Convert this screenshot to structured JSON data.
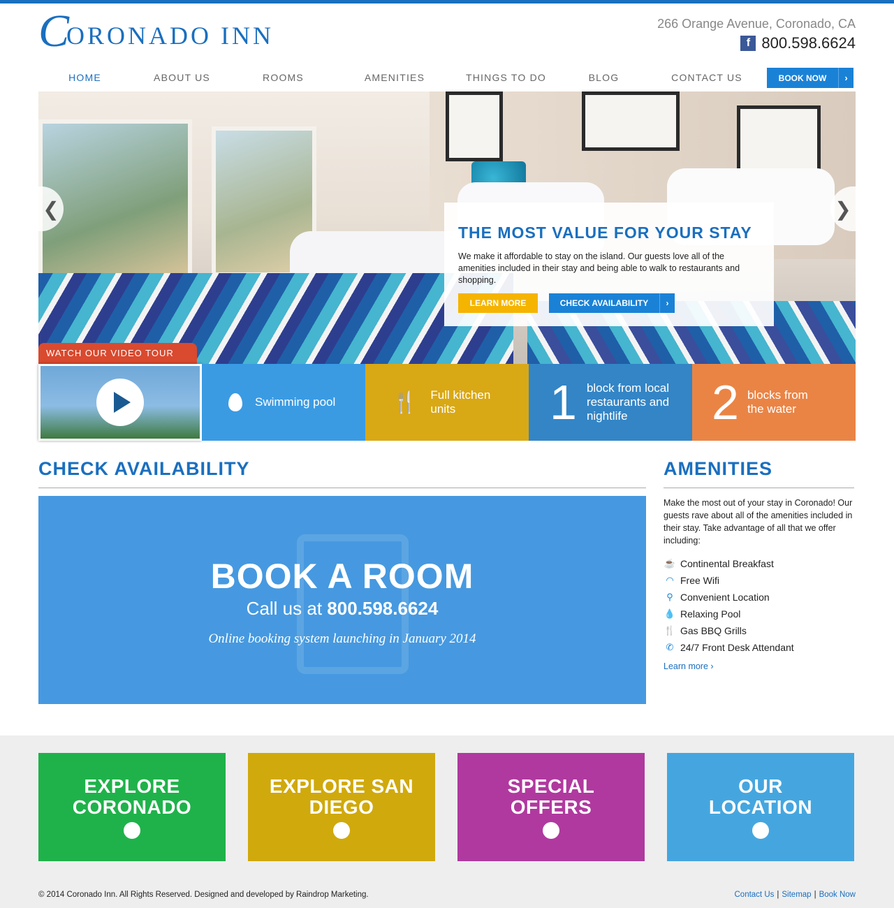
{
  "header": {
    "logo_initial": "C",
    "logo_text": "ORONADO INN",
    "address": "266 Orange Avenue, Coronado, CA",
    "facebook_glyph": "f",
    "phone": "800.598.6624"
  },
  "nav": {
    "items": [
      {
        "label": "HOME",
        "active": true
      },
      {
        "label": "ABOUT US"
      },
      {
        "label": "ROOMS"
      },
      {
        "label": "AMENITIES"
      },
      {
        "label": "THINGS TO DO"
      },
      {
        "label": "BLOG"
      },
      {
        "label": "CONTACT US"
      }
    ],
    "book_now": "BOOK NOW",
    "book_now_arrow": "›"
  },
  "hero": {
    "prev_arrow": "❮",
    "next_arrow": "❯",
    "title": "THE MOST VALUE FOR YOUR STAY",
    "body": "We make it affordable to stay on the island. Our guests love all of the amenities included in their stay and being able to walk to restaurants and shopping.",
    "learn_more": "LEARN MORE",
    "check_availability": "CHECK AVAILABILITY",
    "check_arrow": "›"
  },
  "video_tour": {
    "label": "WATCH OUR VIDEO TOUR"
  },
  "features": [
    {
      "icon": "water-drop-icon",
      "text": "Swimming pool"
    },
    {
      "icon": "fork-knife-icon",
      "glyph": "🍴",
      "text": "Full kitchen units"
    },
    {
      "number": "1",
      "text": "block from local restaurants and nightlife"
    },
    {
      "number": "2",
      "text": "blocks from the water"
    }
  ],
  "availability": {
    "section_title": "CHECK AVAILABILITY",
    "book_title": "BOOK A ROOM",
    "call_prefix": "Call us at ",
    "call_phone": "800.598.6624",
    "note": "Online booking system launching in January 2014"
  },
  "amenities": {
    "section_title": "AMENITIES",
    "intro": "Make the most out of your stay in Coronado! Our guests rave about all of the amenities included in their stay. Take advantage of all that we offer including:",
    "items": [
      {
        "icon": "coffee-cup-icon",
        "glyph": "☕",
        "label": "Continental Breakfast"
      },
      {
        "icon": "wifi-icon",
        "glyph": "◠",
        "label": "Free Wifi"
      },
      {
        "icon": "map-pin-icon",
        "glyph": "⚲",
        "label": "Convenient Location"
      },
      {
        "icon": "water-drop-icon",
        "glyph": "💧",
        "label": "Relaxing Pool"
      },
      {
        "icon": "fork-knife-icon",
        "glyph": "🍴",
        "label": "Gas BBQ Grills"
      },
      {
        "icon": "phone-icon",
        "glyph": "✆",
        "label": "24/7 Front Desk Attendant"
      }
    ],
    "learn_more": "Learn more ›"
  },
  "promos": [
    {
      "title": "EXPLORE CORONADO",
      "color": "#1fb24a"
    },
    {
      "title": "EXPLORE SAN DIEGO",
      "color": "#d0a90c"
    },
    {
      "title": "SPECIAL OFFERS",
      "color": "#b0399f"
    },
    {
      "title": "OUR LOCATION",
      "color": "#45a6df"
    }
  ],
  "promo_arrow": "›",
  "footer": {
    "copyright": "© 2014 Coronado Inn. All Rights Reserved. Designed and developed by Raindrop Marketing.",
    "links": [
      "Contact Us",
      "Sitemap",
      "Book Now"
    ],
    "separator": "|"
  },
  "colors": {
    "brand_blue": "#1a6fbf",
    "button_blue": "#1a82d6",
    "accent_yellow": "#f5b400",
    "video_tab_red": "#d94a2f"
  }
}
